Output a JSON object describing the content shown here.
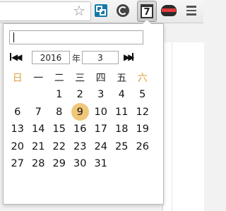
{
  "browser": {
    "toolbar": {
      "star_glyph": "☆",
      "calendar_icon_day": "7"
    }
  },
  "calendar": {
    "input_value": "",
    "nav_first": "◀◀",
    "nav_prev": "◀",
    "nav_next": "▶",
    "nav_last": "▶▶",
    "year": "2016",
    "year_label": "年",
    "month": "3",
    "weekdays": [
      "日",
      "一",
      "二",
      "三",
      "四",
      "五",
      "六"
    ],
    "days": [
      "",
      "",
      "1",
      "2",
      "3",
      "4",
      "5",
      "6",
      "7",
      "8",
      "9",
      "10",
      "11",
      "12",
      "13",
      "14",
      "15",
      "16",
      "17",
      "18",
      "19",
      "20",
      "21",
      "22",
      "23",
      "24",
      "25",
      "26",
      "27",
      "28",
      "29",
      "30",
      "31",
      "",
      ""
    ],
    "today": "9",
    "colors": {
      "weekend_header": "#e0a040",
      "today_highlight": "#f0c778"
    }
  }
}
